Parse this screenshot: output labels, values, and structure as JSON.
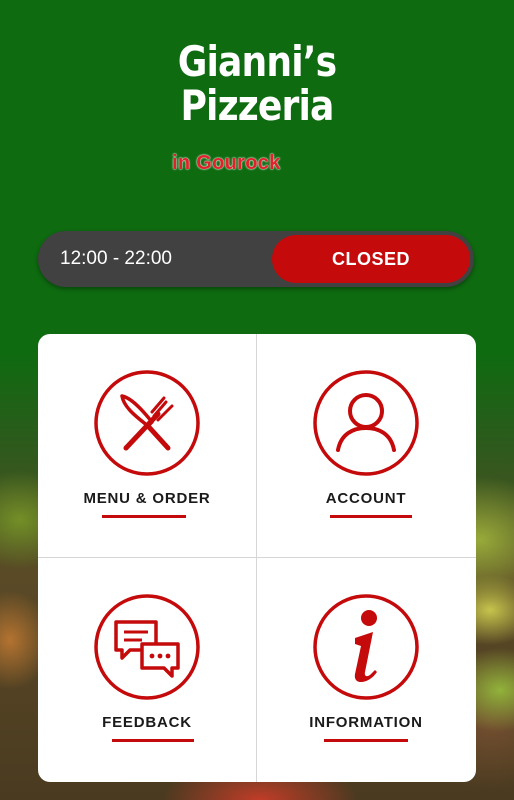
{
  "brand": {
    "name_line1": "Gianni’s",
    "name_line2": "Pizzeria",
    "location": "in Gourock"
  },
  "hours": {
    "text": "12:00 - 22:00",
    "status": "CLOSED"
  },
  "tiles": [
    {
      "label": "MENU & ORDER",
      "icon": "fork-knife-icon"
    },
    {
      "label": "ACCOUNT",
      "icon": "user-icon"
    },
    {
      "label": "FEEDBACK",
      "icon": "chat-bubbles-icon"
    },
    {
      "label": "INFORMATION",
      "icon": "info-icon"
    }
  ],
  "colors": {
    "brand_green": "#0e6b10",
    "accent_red": "#c40a0a",
    "bar_gray": "#414141"
  }
}
